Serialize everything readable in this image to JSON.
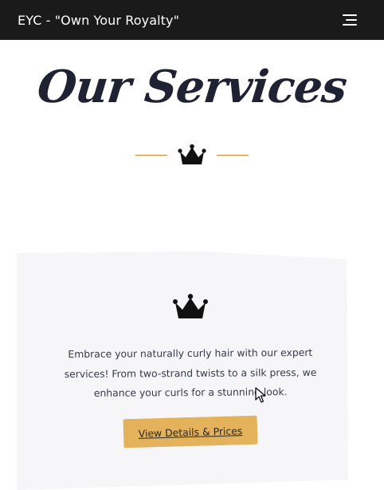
{
  "header": {
    "site_title": "EYC - \"Own Your Royalty\"",
    "menu_icon": "hamburger-menu-icon"
  },
  "section": {
    "title": "Our Services",
    "divider_icon": "crown-icon"
  },
  "service_card": {
    "icon": "crown-icon",
    "description": "Embrace your naturally curly hair with our expert services! From two-strand twists to a silk press, we enhance your curls for a stunning look.",
    "button_label": "View Details & Prices"
  },
  "colors": {
    "header_bg": "#1a1a1a",
    "accent_line": "#d08a2a",
    "button_bg": "#e3b25a",
    "card_bg": "#f6f6f8",
    "heading": "#1e2233"
  }
}
